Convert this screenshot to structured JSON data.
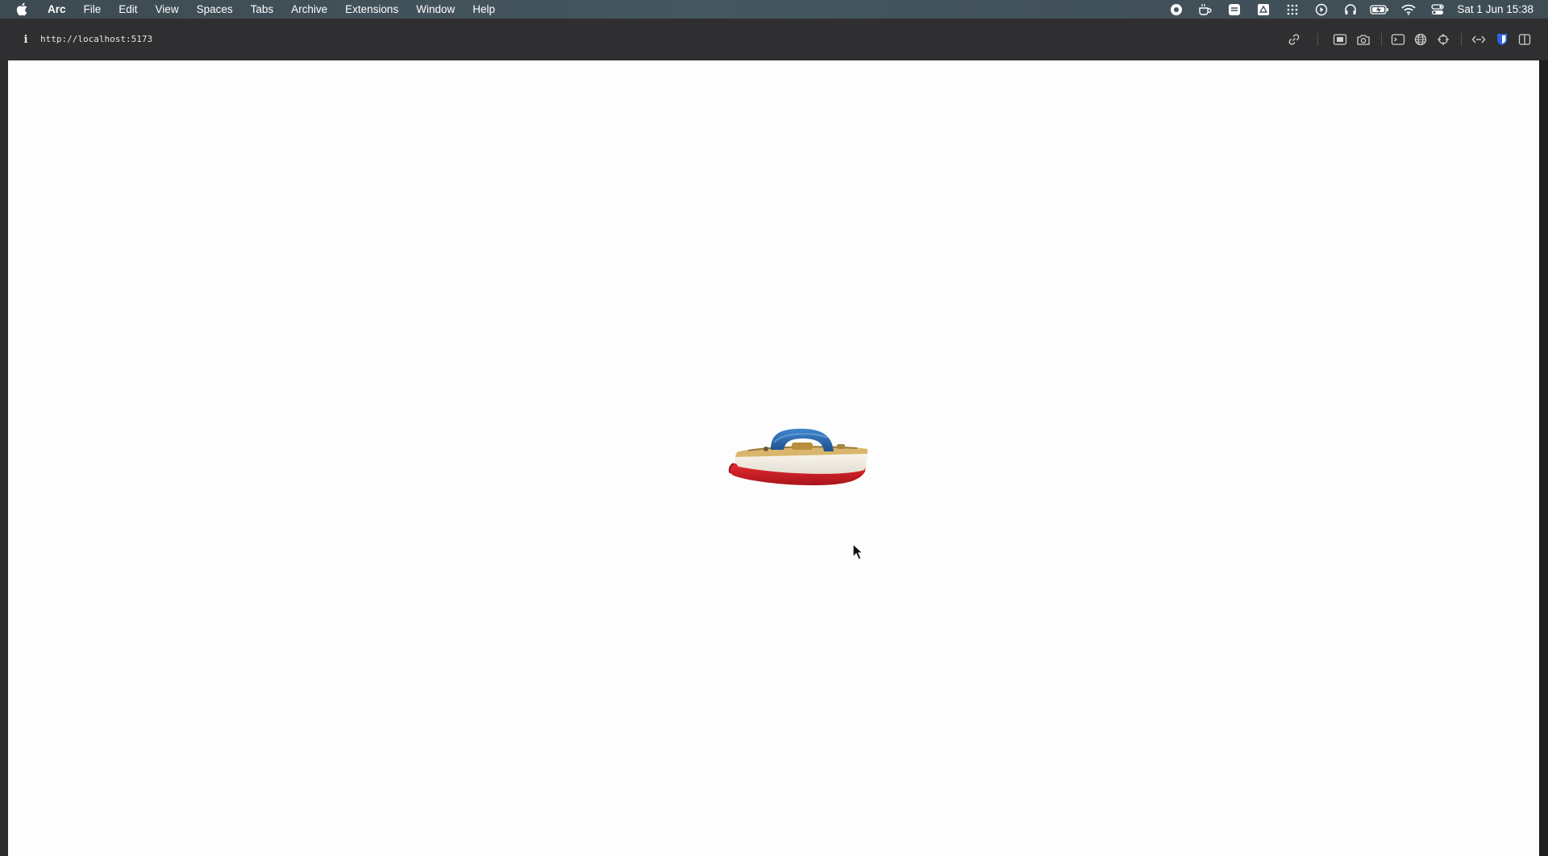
{
  "menubar": {
    "app_name": "Arc",
    "items": [
      "File",
      "Edit",
      "View",
      "Spaces",
      "Tabs",
      "Archive",
      "Extensions",
      "Window",
      "Help"
    ],
    "status_icons": [
      "record-icon",
      "coffee-icon",
      "notes-icon",
      "drive-icon",
      "grid-icon",
      "play-icon",
      "headphones-icon",
      "battery-icon",
      "wifi-icon",
      "control-center-icon"
    ],
    "clock": "Sat 1 Jun  15:38"
  },
  "toolbar": {
    "site_info_icon": "info-icon",
    "url": "http://localhost:5173",
    "icons": [
      "link-icon",
      "capture-icon",
      "camera-icon",
      "terminal-icon",
      "globe-icon",
      "crosshair-icon",
      "extensions-icon",
      "bitwarden-icon",
      "sidebar-toggle-icon"
    ]
  },
  "content": {
    "image": "toy-boat",
    "colors": {
      "hull_red": "#d8202a",
      "hull_white": "#f3efe6",
      "deck_tan": "#d9b66c",
      "cabin_blue": "#2f6db0"
    }
  },
  "colors": {
    "menubar_bg": "#42525a",
    "toolbar_bg": "#2f2f31",
    "page_bg": "#fdfdfd"
  }
}
